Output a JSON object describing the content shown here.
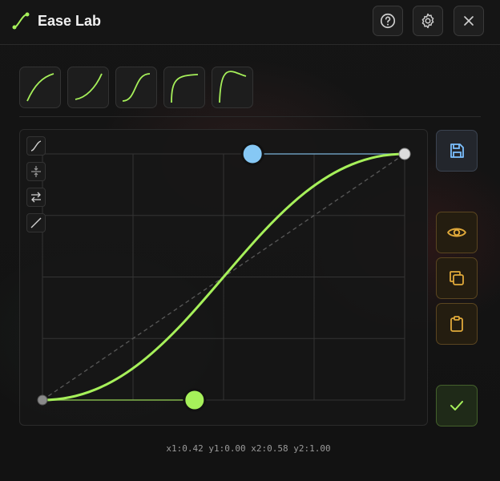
{
  "app": {
    "title": "Ease Lab"
  },
  "header": {
    "buttons": [
      {
        "name": "help",
        "icon": "help-circle-icon"
      },
      {
        "name": "settings",
        "icon": "gear-icon"
      },
      {
        "name": "close",
        "icon": "close-icon"
      }
    ]
  },
  "presets": [
    {
      "icon": "ease-out-curve-icon"
    },
    {
      "icon": "ease-in-curve-icon"
    },
    {
      "icon": "ease-in-out-curve-icon"
    },
    {
      "icon": "ease-out-quick-curve-icon"
    },
    {
      "icon": "overshoot-curve-icon"
    }
  ],
  "tools": [
    {
      "icon": "curve-tool-icon"
    },
    {
      "icon": "flip-vertical-icon"
    },
    {
      "icon": "swap-icon"
    },
    {
      "icon": "linear-icon"
    }
  ],
  "curve": {
    "x1": 0.42,
    "y1": 0.0,
    "x2": 0.58,
    "y2": 1.0
  },
  "colors": {
    "curve": "#a6f05a",
    "handle1": "#a6f05a",
    "handle2": "#86c8f5",
    "accent_amber": "#e0a93a",
    "save_blue": "#7cc0ff"
  },
  "side_buttons": [
    {
      "name": "save",
      "icon": "save-icon"
    },
    {
      "name": "preview",
      "icon": "eye-icon"
    },
    {
      "name": "copy",
      "icon": "copy-icon"
    },
    {
      "name": "paste",
      "icon": "clipboard-icon"
    },
    {
      "name": "confirm",
      "icon": "check-icon"
    }
  ],
  "readout": "x1:0.42 y1:0.00 x2:0.58 y2:1.00"
}
